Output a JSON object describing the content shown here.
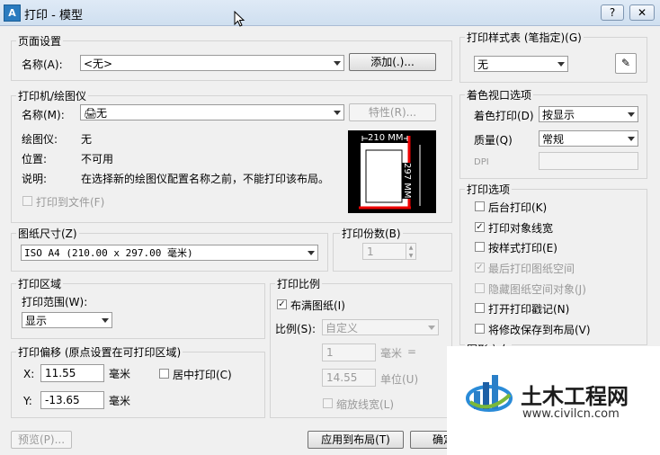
{
  "window": {
    "title": "打印 - 模型",
    "help_label": "?",
    "close_label": "✕"
  },
  "page_setup": {
    "caption": "页面设置",
    "name_label": "名称(A):",
    "name_value": "<无>",
    "add_button": "添加(.)..."
  },
  "printer": {
    "caption": "打印机/绘图仪",
    "name_label": "名称(M):",
    "name_value": "无",
    "properties_button": "特性(R)...",
    "plotter_label": "绘图仪:",
    "plotter_value": "无",
    "location_label": "位置:",
    "location_value": "不可用",
    "description_label": "说明:",
    "description_value": "在选择新的绘图仪配置名称之前，不能打印该布局。",
    "print_to_file": "打印到文件(F)",
    "preview_width": "210 MM",
    "preview_height": "297 MM"
  },
  "paper_size": {
    "caption": "图纸尺寸(Z)",
    "value": "ISO A4 (210.00 x 297.00 毫米)"
  },
  "copies": {
    "caption": "打印份数(B)",
    "value": "1"
  },
  "plot_area": {
    "caption": "打印区域",
    "range_label": "打印范围(W):",
    "range_value": "显示"
  },
  "plot_offset": {
    "caption": "打印偏移 (原点设置在可打印区域)",
    "x_label": "X:",
    "x_value": "11.55",
    "x_unit": "毫米",
    "y_label": "Y:",
    "y_value": "-13.65",
    "y_unit": "毫米",
    "center_label": "居中打印(C)"
  },
  "plot_scale": {
    "caption": "打印比例",
    "fit_label": "布满图纸(I)",
    "scale_label": "比例(S):",
    "scale_value": "自定义",
    "value1": "1",
    "unit1": "毫米",
    "eq": "=",
    "value2": "14.55",
    "unit2": "单位(U)",
    "lineweights_label": "缩放线宽(L)"
  },
  "style_table": {
    "caption": "打印样式表 (笔指定)(G)",
    "value": "无"
  },
  "shaded": {
    "caption": "着色视口选项",
    "shade_label": "着色打印(D)",
    "shade_value": "按显示",
    "quality_label": "质量(Q)",
    "quality_value": "常规",
    "dpi_label": "DPI"
  },
  "options": {
    "caption": "打印选项",
    "items": [
      {
        "label": "后台打印(K)",
        "checked": false,
        "disabled": false
      },
      {
        "label": "打印对象线宽",
        "checked": true,
        "disabled": false
      },
      {
        "label": "按样式打印(E)",
        "checked": false,
        "disabled": false
      },
      {
        "label": "最后打印图纸空间",
        "checked": true,
        "disabled": true
      },
      {
        "label": "隐藏图纸空间对象(J)",
        "checked": false,
        "disabled": true
      },
      {
        "label": "打开打印戳记(N)",
        "checked": false,
        "disabled": false
      },
      {
        "label": "将修改保存到布局(V)",
        "checked": false,
        "disabled": false
      }
    ],
    "partial_caption": "图形方向"
  },
  "footer": {
    "preview_button": "预览(P)...",
    "apply_button": "应用到布局(T)",
    "ok_button": "确定"
  },
  "watermark": {
    "brand": "土木工程网",
    "url": "www.civilcn.com"
  }
}
